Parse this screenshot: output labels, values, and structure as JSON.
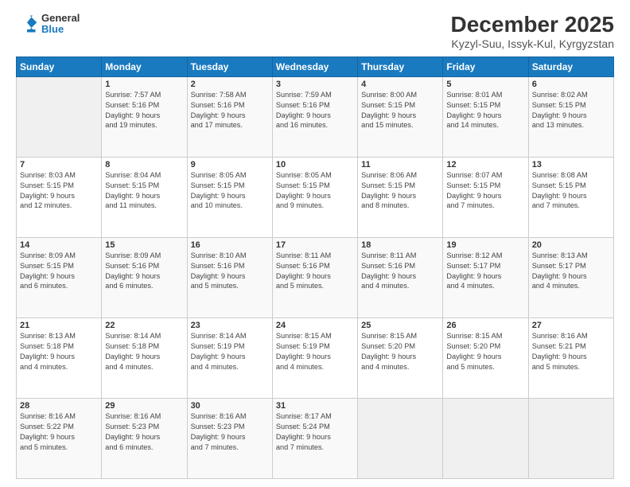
{
  "header": {
    "logo": {
      "line1": "General",
      "line2": "Blue"
    },
    "month": "December 2025",
    "location": "Kyzyl-Suu, Issyk-Kul, Kyrgyzstan"
  },
  "weekdays": [
    "Sunday",
    "Monday",
    "Tuesday",
    "Wednesday",
    "Thursday",
    "Friday",
    "Saturday"
  ],
  "weeks": [
    [
      {
        "day": "",
        "info": ""
      },
      {
        "day": "1",
        "info": "Sunrise: 7:57 AM\nSunset: 5:16 PM\nDaylight: 9 hours\nand 19 minutes."
      },
      {
        "day": "2",
        "info": "Sunrise: 7:58 AM\nSunset: 5:16 PM\nDaylight: 9 hours\nand 17 minutes."
      },
      {
        "day": "3",
        "info": "Sunrise: 7:59 AM\nSunset: 5:16 PM\nDaylight: 9 hours\nand 16 minutes."
      },
      {
        "day": "4",
        "info": "Sunrise: 8:00 AM\nSunset: 5:15 PM\nDaylight: 9 hours\nand 15 minutes."
      },
      {
        "day": "5",
        "info": "Sunrise: 8:01 AM\nSunset: 5:15 PM\nDaylight: 9 hours\nand 14 minutes."
      },
      {
        "day": "6",
        "info": "Sunrise: 8:02 AM\nSunset: 5:15 PM\nDaylight: 9 hours\nand 13 minutes."
      }
    ],
    [
      {
        "day": "7",
        "info": "Sunrise: 8:03 AM\nSunset: 5:15 PM\nDaylight: 9 hours\nand 12 minutes."
      },
      {
        "day": "8",
        "info": "Sunrise: 8:04 AM\nSunset: 5:15 PM\nDaylight: 9 hours\nand 11 minutes."
      },
      {
        "day": "9",
        "info": "Sunrise: 8:05 AM\nSunset: 5:15 PM\nDaylight: 9 hours\nand 10 minutes."
      },
      {
        "day": "10",
        "info": "Sunrise: 8:05 AM\nSunset: 5:15 PM\nDaylight: 9 hours\nand 9 minutes."
      },
      {
        "day": "11",
        "info": "Sunrise: 8:06 AM\nSunset: 5:15 PM\nDaylight: 9 hours\nand 8 minutes."
      },
      {
        "day": "12",
        "info": "Sunrise: 8:07 AM\nSunset: 5:15 PM\nDaylight: 9 hours\nand 7 minutes."
      },
      {
        "day": "13",
        "info": "Sunrise: 8:08 AM\nSunset: 5:15 PM\nDaylight: 9 hours\nand 7 minutes."
      }
    ],
    [
      {
        "day": "14",
        "info": "Sunrise: 8:09 AM\nSunset: 5:15 PM\nDaylight: 9 hours\nand 6 minutes."
      },
      {
        "day": "15",
        "info": "Sunrise: 8:09 AM\nSunset: 5:16 PM\nDaylight: 9 hours\nand 6 minutes."
      },
      {
        "day": "16",
        "info": "Sunrise: 8:10 AM\nSunset: 5:16 PM\nDaylight: 9 hours\nand 5 minutes."
      },
      {
        "day": "17",
        "info": "Sunrise: 8:11 AM\nSunset: 5:16 PM\nDaylight: 9 hours\nand 5 minutes."
      },
      {
        "day": "18",
        "info": "Sunrise: 8:11 AM\nSunset: 5:16 PM\nDaylight: 9 hours\nand 4 minutes."
      },
      {
        "day": "19",
        "info": "Sunrise: 8:12 AM\nSunset: 5:17 PM\nDaylight: 9 hours\nand 4 minutes."
      },
      {
        "day": "20",
        "info": "Sunrise: 8:13 AM\nSunset: 5:17 PM\nDaylight: 9 hours\nand 4 minutes."
      }
    ],
    [
      {
        "day": "21",
        "info": "Sunrise: 8:13 AM\nSunset: 5:18 PM\nDaylight: 9 hours\nand 4 minutes."
      },
      {
        "day": "22",
        "info": "Sunrise: 8:14 AM\nSunset: 5:18 PM\nDaylight: 9 hours\nand 4 minutes."
      },
      {
        "day": "23",
        "info": "Sunrise: 8:14 AM\nSunset: 5:19 PM\nDaylight: 9 hours\nand 4 minutes."
      },
      {
        "day": "24",
        "info": "Sunrise: 8:15 AM\nSunset: 5:19 PM\nDaylight: 9 hours\nand 4 minutes."
      },
      {
        "day": "25",
        "info": "Sunrise: 8:15 AM\nSunset: 5:20 PM\nDaylight: 9 hours\nand 4 minutes."
      },
      {
        "day": "26",
        "info": "Sunrise: 8:15 AM\nSunset: 5:20 PM\nDaylight: 9 hours\nand 5 minutes."
      },
      {
        "day": "27",
        "info": "Sunrise: 8:16 AM\nSunset: 5:21 PM\nDaylight: 9 hours\nand 5 minutes."
      }
    ],
    [
      {
        "day": "28",
        "info": "Sunrise: 8:16 AM\nSunset: 5:22 PM\nDaylight: 9 hours\nand 5 minutes."
      },
      {
        "day": "29",
        "info": "Sunrise: 8:16 AM\nSunset: 5:23 PM\nDaylight: 9 hours\nand 6 minutes."
      },
      {
        "day": "30",
        "info": "Sunrise: 8:16 AM\nSunset: 5:23 PM\nDaylight: 9 hours\nand 7 minutes."
      },
      {
        "day": "31",
        "info": "Sunrise: 8:17 AM\nSunset: 5:24 PM\nDaylight: 9 hours\nand 7 minutes."
      },
      {
        "day": "",
        "info": ""
      },
      {
        "day": "",
        "info": ""
      },
      {
        "day": "",
        "info": ""
      }
    ]
  ]
}
